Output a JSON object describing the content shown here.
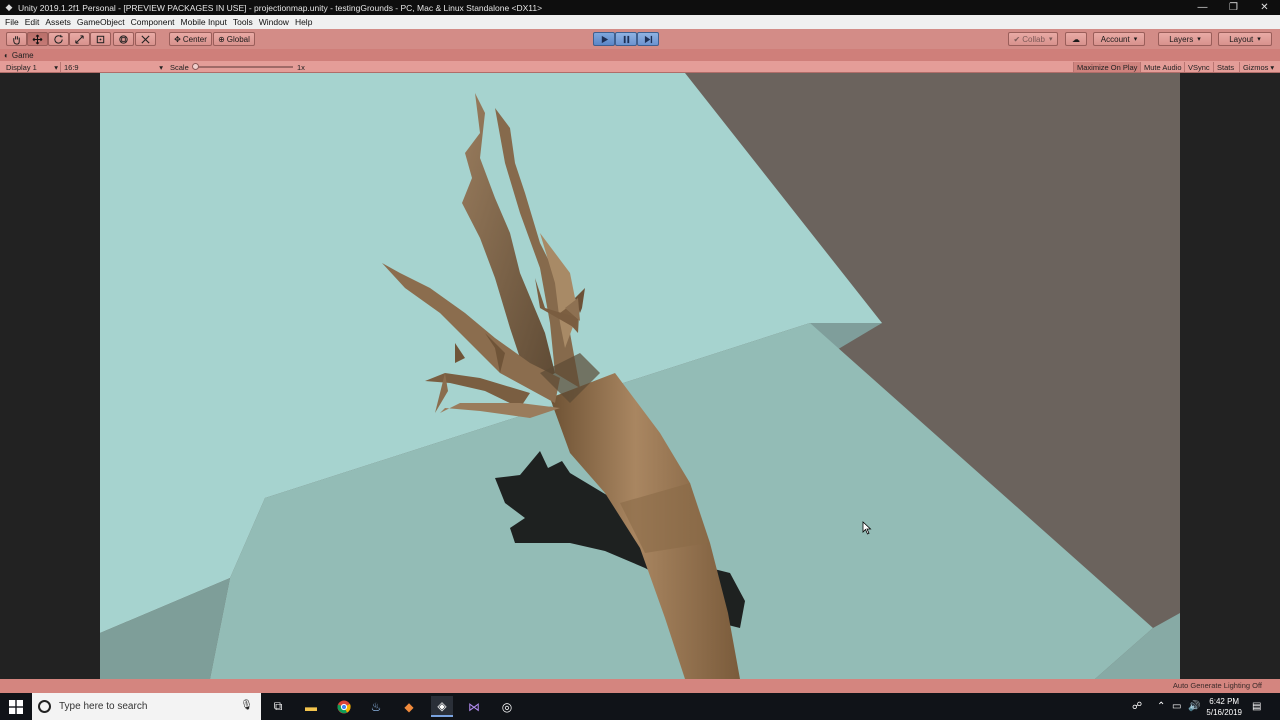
{
  "window": {
    "title": "Unity 2019.1.2f1 Personal - [PREVIEW PACKAGES IN USE] - projectionmap.unity - testingGrounds - PC, Mac & Linux Standalone <DX11>",
    "controls": {
      "minimize": "—",
      "restore": "❐",
      "close": "✕"
    }
  },
  "menu": [
    "File",
    "Edit",
    "Assets",
    "GameObject",
    "Component",
    "Mobile Input",
    "Tools",
    "Window",
    "Help"
  ],
  "toolbar": {
    "pivot_label": "Center",
    "space_label": "Global",
    "collab_label": "Collab",
    "account_label": "Account",
    "layers_label": "Layers",
    "layout_label": "Layout"
  },
  "game_panel": {
    "tab_label": "Game",
    "display_label": "Display 1",
    "aspect_label": "16:9",
    "scale_label": "Scale",
    "scale_value": "1x",
    "buttons": {
      "maximize": "Maximize On Play",
      "mute": "Mute Audio",
      "vsync": "VSync",
      "stats": "Stats",
      "gizmos": "Gizmos"
    }
  },
  "statusbar": {
    "text": "Auto Generate Lighting Off"
  },
  "taskbar": {
    "search_placeholder": "Type here to search",
    "time": "6:42 PM",
    "date": "5/16/2019"
  },
  "colors": {
    "toolbar_tint": "#d38c87",
    "play_active": "#5b86c7",
    "sky_plane": "#a6d3cf",
    "ground_plane": "#93bcb6",
    "background_wall": "#6b635d"
  }
}
